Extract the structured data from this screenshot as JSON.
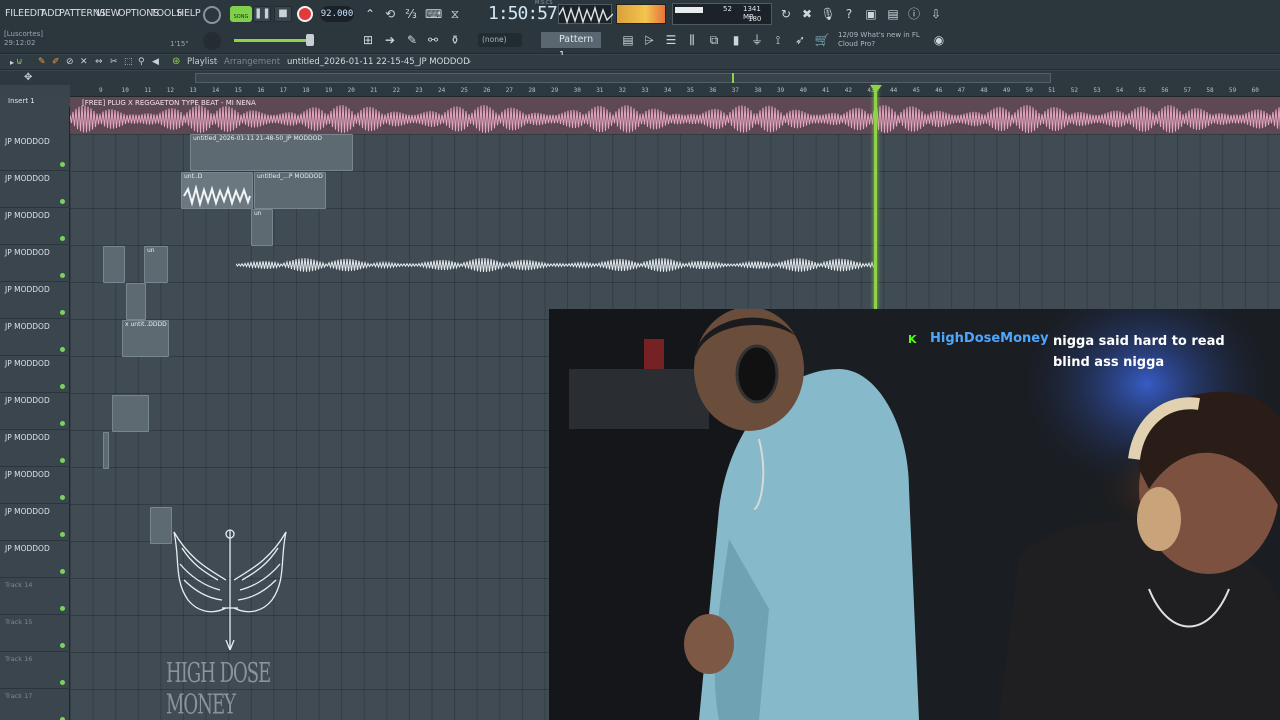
{
  "menu": [
    "FILE",
    "EDIT",
    "ADD",
    "PATTERNS",
    "VIEW",
    "OPTIONS",
    "TOOLS",
    "HELP"
  ],
  "hint": {
    "line1": "[Luscortes]",
    "line2": "29:12:02",
    "zoom": "1'15\""
  },
  "transport": {
    "song_label": "SONG",
    "tempo": "92.000",
    "time": "1:50:57",
    "time_unit": "M:S:CS"
  },
  "monitor": {
    "cpu": "52",
    "ram": "1341 MB",
    "polyphony": "180"
  },
  "pattern": {
    "selected": "Pattern 1",
    "none_label": "(none)"
  },
  "news": {
    "time": "12/09",
    "text": "What's new in FL Cloud Pro?"
  },
  "playlist": {
    "title": "Playlist",
    "view": "Arrangement",
    "filename": "untitled_2026-01-11 22-15-45_JP MODDOD"
  },
  "ruler": [
    "9",
    "10",
    "11",
    "12",
    "13",
    "14",
    "15",
    "16",
    "17",
    "18",
    "19",
    "20",
    "21",
    "22",
    "23",
    "24",
    "25",
    "26",
    "27",
    "28",
    "29",
    "30",
    "31",
    "32",
    "33",
    "34",
    "35",
    "36",
    "37",
    "38",
    "39",
    "40",
    "41",
    "42",
    "43",
    "44",
    "45",
    "46",
    "47",
    "48",
    "49",
    "50",
    "51",
    "52",
    "53",
    "54",
    "55",
    "56",
    "57",
    "58",
    "59",
    "60"
  ],
  "insert_label": "Insert 1",
  "beat_clip": "[FREE] PLUG X REGGAETON TYPE BEAT - MI NENA",
  "tracks": [
    "JP MODDOD",
    "JP MODDOD",
    "JP MODDOD",
    "JP MODDOD",
    "JP MODDOD",
    "JP MODDOD",
    "JP MODDOD",
    "JP MODDOD",
    "JP MODDOD",
    "JP MODDOD",
    "JP MODDOD",
    "JP MODDOD",
    "Track 14",
    "Track 15",
    "Track 16",
    "Track 17"
  ],
  "clips": {
    "c1": "untitled_2026-01-11 21-48-50_JP MODDOD",
    "c2a": "unt..D",
    "c2b": "untitled_...P MODDOD",
    "c3": "un",
    "c4": "x untit..DDDD",
    "c5": "un"
  },
  "chat": {
    "username": "HighDoseMoney",
    "message": "nigga said hard to read blind ass nigga"
  },
  "watermark": "HIGH DOSE MONEY",
  "colors": {
    "playhead": "#8fd34b",
    "chat_user": "#4fa6ff",
    "record": "#e23a3a",
    "beat_wave": "#e7a6c1"
  }
}
